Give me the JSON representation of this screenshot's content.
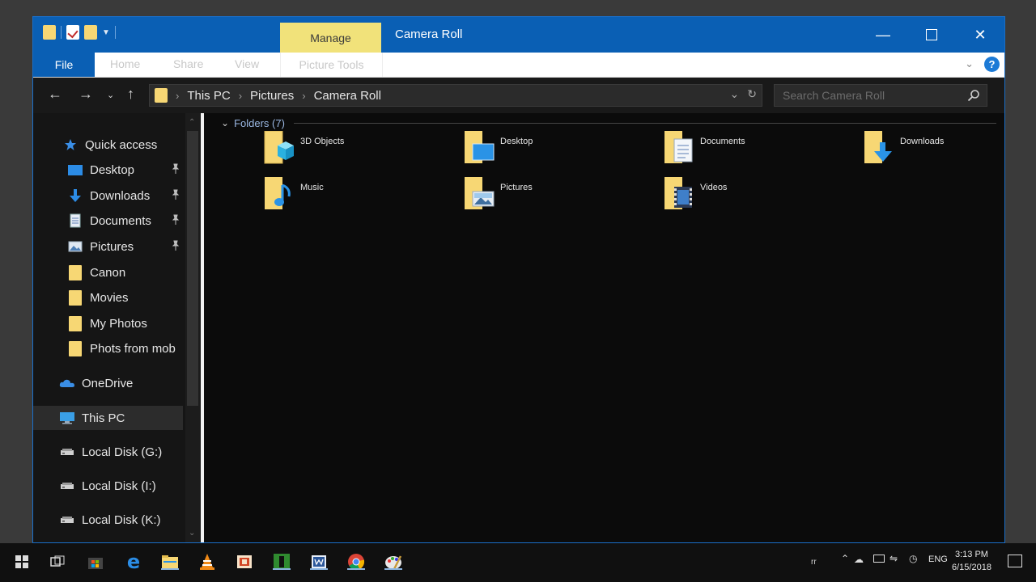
{
  "window": {
    "title": "Camera Roll",
    "contextual_tab": "Manage",
    "caption_buttons": [
      "minimize-icon",
      "maximize-icon",
      "close-icon"
    ]
  },
  "ribbon": {
    "file": "File",
    "tabs": [
      "Home",
      "Share",
      "View"
    ],
    "contextual_group": "Picture Tools",
    "help": "?"
  },
  "address": {
    "crumbs": [
      "This PC",
      "Pictures",
      "Camera Roll"
    ]
  },
  "search": {
    "placeholder": "Search Camera Roll"
  },
  "sidebar": {
    "items": [
      {
        "label": "Quick access",
        "icon": "star-icon",
        "pinned": false
      },
      {
        "label": "Desktop",
        "icon": "desktop-icon",
        "pinned": true
      },
      {
        "label": "Downloads",
        "icon": "download-icon",
        "pinned": true
      },
      {
        "label": "Documents",
        "icon": "document-icon",
        "pinned": true
      },
      {
        "label": "Pictures",
        "icon": "pictures-icon",
        "pinned": true
      },
      {
        "label": "Canon",
        "icon": "folder-icon",
        "pinned": false
      },
      {
        "label": "Movies",
        "icon": "folder-icon",
        "pinned": false
      },
      {
        "label": "My Photos",
        "icon": "folder-icon",
        "pinned": false
      },
      {
        "label": "Phots from mob",
        "icon": "folder-icon",
        "pinned": false
      },
      {
        "label": "OneDrive",
        "icon": "cloud-icon",
        "pinned": false
      },
      {
        "label": "This PC",
        "icon": "computer-icon",
        "pinned": false
      },
      {
        "label": "Local Disk (G:)",
        "icon": "drive-icon",
        "pinned": false
      },
      {
        "label": "Local Disk (I:)",
        "icon": "drive-icon",
        "pinned": false
      },
      {
        "label": "Local Disk (K:)",
        "icon": "drive-icon",
        "pinned": false
      }
    ]
  },
  "content": {
    "group_header": "Folders (7)",
    "folders": [
      {
        "name": "3D Objects",
        "icon": "3d-objects-folder-icon"
      },
      {
        "name": "Desktop",
        "icon": "desktop-folder-icon"
      },
      {
        "name": "Documents",
        "icon": "documents-folder-icon"
      },
      {
        "name": "Downloads",
        "icon": "downloads-folder-icon"
      },
      {
        "name": "Music",
        "icon": "music-folder-icon"
      },
      {
        "name": "Pictures",
        "icon": "pictures-folder-icon"
      },
      {
        "name": "Videos",
        "icon": "videos-folder-icon"
      }
    ]
  },
  "taskbar": {
    "apps": [
      "start-icon",
      "task-view-icon",
      "store-icon",
      "edge-icon",
      "file-explorer-icon",
      "vlc-icon",
      "powerpoint-icon",
      "camtasia-icon",
      "word-icon",
      "chrome-icon",
      "paint-icon"
    ],
    "language": "ENG",
    "time": "3:13 PM",
    "date": "6/15/2018"
  },
  "colors": {
    "accent": "#0a5fb4",
    "manage_tab": "#f1e27a",
    "folder": "#f7d774"
  }
}
